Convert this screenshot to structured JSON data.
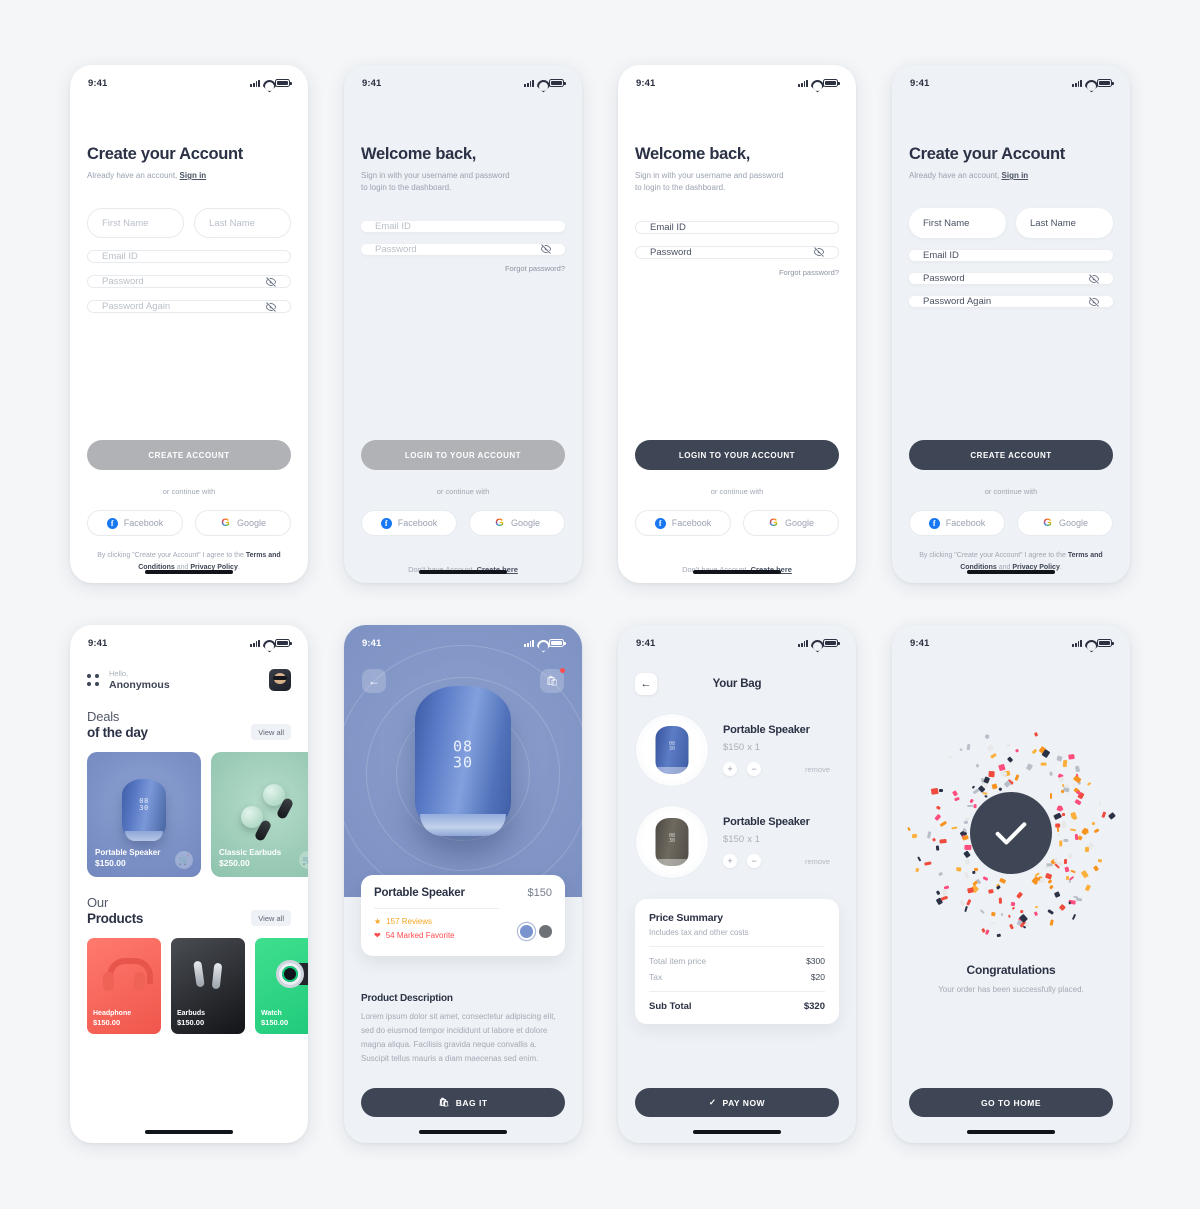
{
  "status_bar": {
    "time": "9:41"
  },
  "screens": {
    "signup_empty": {
      "title": "Create your Account",
      "sub_prefix": "Already have an account,",
      "sub_link": "Sign in",
      "first_name": "First Name",
      "last_name": "Last Name",
      "email": "Email ID",
      "password": "Password",
      "password_again": "Password Again",
      "cta": "CREATE ACCOUNT",
      "continue_with": "or continue with",
      "facebook": "Facebook",
      "google": "Google",
      "legal_1": "By clicking \"Create your Account\" I agree to the",
      "legal_terms": "Terms and Conditions",
      "legal_and": "and",
      "legal_privacy": "Privacy Policy",
      "legal_end": "."
    },
    "login_muted": {
      "title": "Welcome back,",
      "sub_line1": "Sign in with your username and password",
      "sub_line2": "to login to the dashboard.",
      "email": "Email ID",
      "password": "Password",
      "forgot": "Forgot password?",
      "cta": "LOGIN TO YOUR ACCOUNT",
      "continue_with": "or continue with",
      "facebook": "Facebook",
      "google": "Google",
      "bottom_prefix": "Don't have Account,",
      "bottom_link": "Create here"
    },
    "login_active": {
      "title": "Welcome back,",
      "sub_line1": "Sign in with your username and password",
      "sub_line2": "to login to the dashboard.",
      "email": "Email ID",
      "password": "Password",
      "forgot": "Forgot password?",
      "cta": "LOGIN TO YOUR ACCOUNT",
      "continue_with": "or continue with",
      "facebook": "Facebook",
      "google": "Google",
      "bottom_prefix": "Don't have Account,",
      "bottom_link": "Create here"
    },
    "signup_filled": {
      "title": "Create your Account",
      "sub_prefix": "Already have an account,",
      "sub_link": "Sign in",
      "first_name": "First Name",
      "last_name": "Last Name",
      "email": "Email ID",
      "password": "Password",
      "password_again": "Password Again",
      "cta": "CREATE ACCOUNT",
      "continue_with": "or continue with",
      "facebook": "Facebook",
      "google": "Google",
      "legal_1": "By clicking \"Create your Account\" I agree to the",
      "legal_terms": "Terms and Conditions",
      "legal_and": "and",
      "legal_privacy": "Privacy Policy",
      "legal_end": "."
    },
    "home": {
      "greeting": "Hello,",
      "user": "Anonymous",
      "deals_t1": "Deals",
      "deals_t2": "of the day",
      "view_all": "View all",
      "deals": [
        {
          "name": "Portable Speaker",
          "price": "$150.00",
          "display": "08\n30"
        },
        {
          "name": "Classic Earbuds",
          "price": "$250.00"
        }
      ],
      "products_t1": "Our",
      "products_t2": "Products",
      "products_view_all": "View all",
      "products": [
        {
          "name": "Headphone",
          "price": "$150.00"
        },
        {
          "name": "Earbuds",
          "price": "$150.00"
        },
        {
          "name": "Watch",
          "price": "$150.00"
        }
      ]
    },
    "product": {
      "display": "08\n30",
      "name": "Portable Speaker",
      "price": "$150",
      "reviews": "157 Reviews",
      "favorites": "54 Marked Favorite",
      "colors": [
        "#7a94ce",
        "#6e7277"
      ],
      "desc_title": "Product Description",
      "desc_body": "Lorem ipsum dolor sit amet, consectetur adipiscing elit, sed do eiusmod tempor incididunt ut labore et dolore magna aliqua. Facilisis gravida neque convallis a. Suscipit tellus mauris a diam maecenas sed enim.",
      "cta": "BAG IT"
    },
    "bag": {
      "title": "Your Bag",
      "items": [
        {
          "name": "Portable Speaker",
          "price": "$150",
          "qty": "x 1",
          "remove": "remove",
          "display": "08\n30",
          "color": "blue"
        },
        {
          "name": "Portable Speaker",
          "price": "$150",
          "qty": "x 1",
          "remove": "remove",
          "display": "08\n30",
          "color": "dark"
        }
      ],
      "summary_title": "Price Summary",
      "summary_sub": "Includes tax and other costs",
      "rows": [
        {
          "label": "Total item price",
          "value": "$300"
        },
        {
          "label": "Tax",
          "value": "$20"
        }
      ],
      "total_label": "Sub Total",
      "total_value": "$320",
      "cta": "PAY NOW"
    },
    "success": {
      "title": "Congratulations",
      "message": "Your order has been successfully placed.",
      "cta": "GO TO HOME"
    }
  },
  "colors": {
    "page_bg": "#f4f6f8",
    "gray_screen_bg": "#eef1f5",
    "dark_button": "#3e4555",
    "muted_button": "#b0b2b6",
    "heading": "#2b3245",
    "placeholder": "#b9bfc9"
  }
}
